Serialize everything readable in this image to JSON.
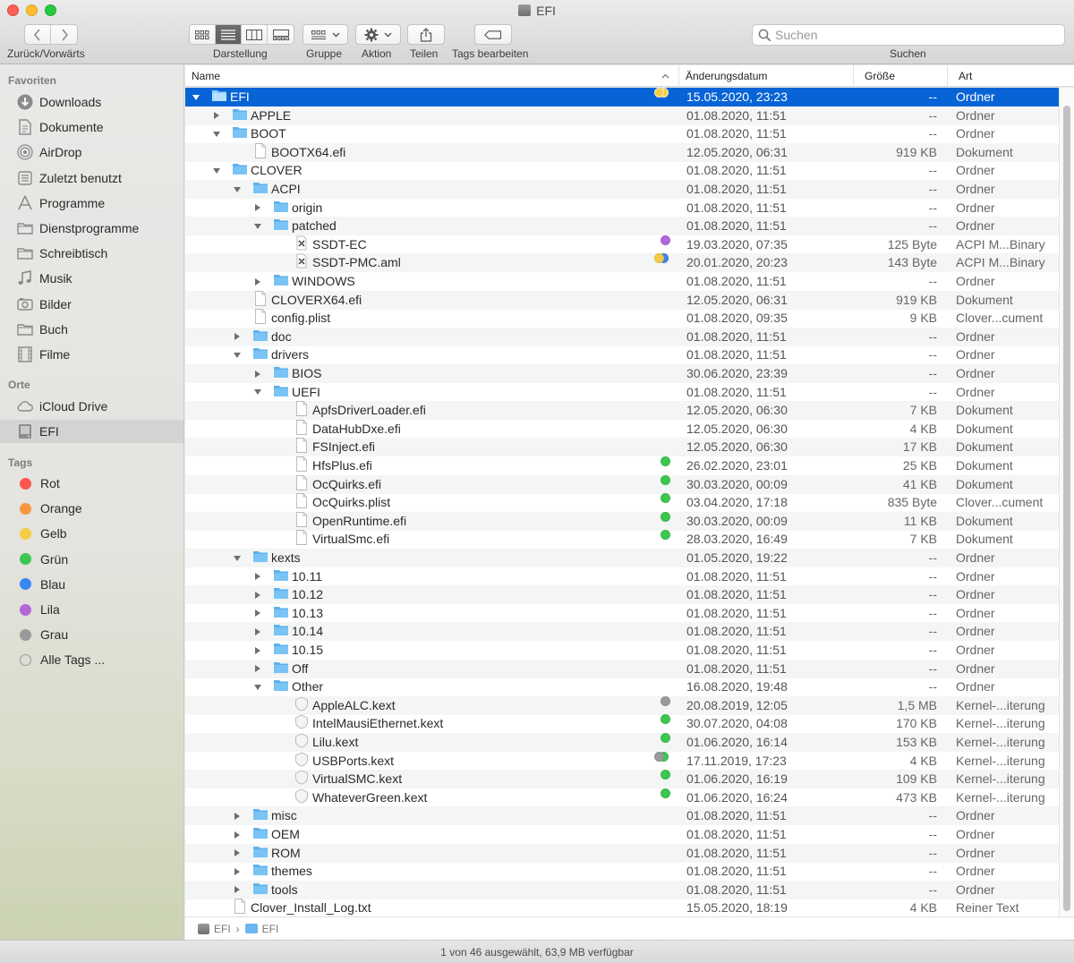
{
  "window": {
    "title": "EFI",
    "nav_label": "Zurück/Vorwärts",
    "toolbar": {
      "view_label": "Darstellung",
      "group_label": "Gruppe",
      "action_label": "Aktion",
      "share_label": "Teilen",
      "tags_label": "Tags bearbeiten",
      "search_label": "Suchen",
      "search_placeholder": "Suchen"
    }
  },
  "sidebar": {
    "favorites_heading": "Favoriten",
    "favorites": [
      {
        "label": "Downloads",
        "icon": "download-icon"
      },
      {
        "label": "Dokumente",
        "icon": "document-icon"
      },
      {
        "label": "AirDrop",
        "icon": "airdrop-icon"
      },
      {
        "label": "Zuletzt benutzt",
        "icon": "recents-icon"
      },
      {
        "label": "Programme",
        "icon": "applications-icon"
      },
      {
        "label": "Dienstprogramme",
        "icon": "folder-icon"
      },
      {
        "label": "Schreibtisch",
        "icon": "folder-icon"
      },
      {
        "label": "Musik",
        "icon": "music-icon"
      },
      {
        "label": "Bilder",
        "icon": "camera-icon"
      },
      {
        "label": "Buch",
        "icon": "folder-icon"
      },
      {
        "label": "Filme",
        "icon": "film-icon"
      }
    ],
    "locations_heading": "Orte",
    "locations": [
      {
        "label": "iCloud Drive",
        "icon": "cloud-icon"
      },
      {
        "label": "EFI",
        "icon": "drive-icon",
        "selected": true
      }
    ],
    "tags_heading": "Tags",
    "tags": [
      {
        "label": "Rot",
        "color": "#fa5650"
      },
      {
        "label": "Orange",
        "color": "#f8963c"
      },
      {
        "label": "Gelb",
        "color": "#f7cc45"
      },
      {
        "label": "Grün",
        "color": "#3cc750"
      },
      {
        "label": "Blau",
        "color": "#3b85f1"
      },
      {
        "label": "Lila",
        "color": "#b466d9"
      },
      {
        "label": "Grau",
        "color": "#9a9a9c"
      },
      {
        "label": "Alle Tags ...",
        "color": ""
      }
    ]
  },
  "columns": {
    "name": "Name",
    "date": "Änderungsdatum",
    "size": "Größe",
    "kind": "Art"
  },
  "files": [
    {
      "name": "EFI",
      "date": "15.05.2020, 23:23",
      "size": "--",
      "kind": "Ordner",
      "depth": 0,
      "type": "folder",
      "disclosure": "open",
      "tags": [
        "#f7cc45",
        "#f7cc45"
      ],
      "selected": true
    },
    {
      "name": "APPLE",
      "date": "01.08.2020, 11:51",
      "size": "--",
      "kind": "Ordner",
      "depth": 1,
      "type": "folder",
      "disclosure": "closed",
      "tags": []
    },
    {
      "name": "BOOT",
      "date": "01.08.2020, 11:51",
      "size": "--",
      "kind": "Ordner",
      "depth": 1,
      "type": "folder",
      "disclosure": "open",
      "tags": []
    },
    {
      "name": "BOOTX64.efi",
      "date": "12.05.2020, 06:31",
      "size": "919 KB",
      "kind": "Dokument",
      "depth": 2,
      "type": "doc",
      "disclosure": "",
      "tags": []
    },
    {
      "name": "CLOVER",
      "date": "01.08.2020, 11:51",
      "size": "--",
      "kind": "Ordner",
      "depth": 1,
      "type": "folder",
      "disclosure": "open",
      "tags": []
    },
    {
      "name": "ACPI",
      "date": "01.08.2020, 11:51",
      "size": "--",
      "kind": "Ordner",
      "depth": 2,
      "type": "folder",
      "disclosure": "open",
      "tags": []
    },
    {
      "name": "origin",
      "date": "01.08.2020, 11:51",
      "size": "--",
      "kind": "Ordner",
      "depth": 3,
      "type": "folder",
      "disclosure": "closed",
      "tags": []
    },
    {
      "name": "patched",
      "date": "01.08.2020, 11:51",
      "size": "--",
      "kind": "Ordner",
      "depth": 3,
      "type": "folder",
      "disclosure": "open",
      "tags": []
    },
    {
      "name": "SSDT-EC",
      "date": "19.03.2020, 07:35",
      "size": "125 Byte",
      "kind": "ACPI M...Binary",
      "depth": 4,
      "type": "binary",
      "disclosure": "",
      "tags": [
        "#b466d9"
      ]
    },
    {
      "name": "SSDT-PMC.aml",
      "date": "20.01.2020, 20:23",
      "size": "143 Byte",
      "kind": "ACPI M...Binary",
      "depth": 4,
      "type": "binary",
      "disclosure": "",
      "tags": [
        "#f7cc45",
        "#3b85f1"
      ]
    },
    {
      "name": "WINDOWS",
      "date": "01.08.2020, 11:51",
      "size": "--",
      "kind": "Ordner",
      "depth": 3,
      "type": "folder",
      "disclosure": "closed",
      "tags": []
    },
    {
      "name": "CLOVERX64.efi",
      "date": "12.05.2020, 06:31",
      "size": "919 KB",
      "kind": "Dokument",
      "depth": 2,
      "type": "doc",
      "disclosure": "",
      "tags": []
    },
    {
      "name": "config.plist",
      "date": "01.08.2020, 09:35",
      "size": "9 KB",
      "kind": "Clover...cument",
      "depth": 2,
      "type": "doc",
      "disclosure": "",
      "tags": []
    },
    {
      "name": "doc",
      "date": "01.08.2020, 11:51",
      "size": "--",
      "kind": "Ordner",
      "depth": 2,
      "type": "folder",
      "disclosure": "closed",
      "tags": []
    },
    {
      "name": "drivers",
      "date": "01.08.2020, 11:51",
      "size": "--",
      "kind": "Ordner",
      "depth": 2,
      "type": "folder",
      "disclosure": "open",
      "tags": []
    },
    {
      "name": "BIOS",
      "date": "30.06.2020, 23:39",
      "size": "--",
      "kind": "Ordner",
      "depth": 3,
      "type": "folder",
      "disclosure": "closed",
      "tags": []
    },
    {
      "name": "UEFI",
      "date": "01.08.2020, 11:51",
      "size": "--",
      "kind": "Ordner",
      "depth": 3,
      "type": "folder",
      "disclosure": "open",
      "tags": []
    },
    {
      "name": "ApfsDriverLoader.efi",
      "date": "12.05.2020, 06:30",
      "size": "7 KB",
      "kind": "Dokument",
      "depth": 4,
      "type": "doc",
      "disclosure": "",
      "tags": []
    },
    {
      "name": "DataHubDxe.efi",
      "date": "12.05.2020, 06:30",
      "size": "4 KB",
      "kind": "Dokument",
      "depth": 4,
      "type": "doc",
      "disclosure": "",
      "tags": []
    },
    {
      "name": "FSInject.efi",
      "date": "12.05.2020, 06:30",
      "size": "17 KB",
      "kind": "Dokument",
      "depth": 4,
      "type": "doc",
      "disclosure": "",
      "tags": []
    },
    {
      "name": "HfsPlus.efi",
      "date": "26.02.2020, 23:01",
      "size": "25 KB",
      "kind": "Dokument",
      "depth": 4,
      "type": "doc",
      "disclosure": "",
      "tags": [
        "#3cc750"
      ]
    },
    {
      "name": "OcQuirks.efi",
      "date": "30.03.2020, 00:09",
      "size": "41 KB",
      "kind": "Dokument",
      "depth": 4,
      "type": "doc",
      "disclosure": "",
      "tags": [
        "#3cc750"
      ]
    },
    {
      "name": "OcQuirks.plist",
      "date": "03.04.2020, 17:18",
      "size": "835 Byte",
      "kind": "Clover...cument",
      "depth": 4,
      "type": "doc",
      "disclosure": "",
      "tags": [
        "#3cc750"
      ]
    },
    {
      "name": "OpenRuntime.efi",
      "date": "30.03.2020, 00:09",
      "size": "11 KB",
      "kind": "Dokument",
      "depth": 4,
      "type": "doc",
      "disclosure": "",
      "tags": [
        "#3cc750"
      ]
    },
    {
      "name": "VirtualSmc.efi",
      "date": "28.03.2020, 16:49",
      "size": "7 KB",
      "kind": "Dokument",
      "depth": 4,
      "type": "doc",
      "disclosure": "",
      "tags": [
        "#3cc750"
      ]
    },
    {
      "name": "kexts",
      "date": "01.05.2020, 19:22",
      "size": "--",
      "kind": "Ordner",
      "depth": 2,
      "type": "folder",
      "disclosure": "open",
      "tags": []
    },
    {
      "name": "10.11",
      "date": "01.08.2020, 11:51",
      "size": "--",
      "kind": "Ordner",
      "depth": 3,
      "type": "folder",
      "disclosure": "closed",
      "tags": []
    },
    {
      "name": "10.12",
      "date": "01.08.2020, 11:51",
      "size": "--",
      "kind": "Ordner",
      "depth": 3,
      "type": "folder",
      "disclosure": "closed",
      "tags": []
    },
    {
      "name": "10.13",
      "date": "01.08.2020, 11:51",
      "size": "--",
      "kind": "Ordner",
      "depth": 3,
      "type": "folder",
      "disclosure": "closed",
      "tags": []
    },
    {
      "name": "10.14",
      "date": "01.08.2020, 11:51",
      "size": "--",
      "kind": "Ordner",
      "depth": 3,
      "type": "folder",
      "disclosure": "closed",
      "tags": []
    },
    {
      "name": "10.15",
      "date": "01.08.2020, 11:51",
      "size": "--",
      "kind": "Ordner",
      "depth": 3,
      "type": "folder",
      "disclosure": "closed",
      "tags": []
    },
    {
      "name": "Off",
      "date": "01.08.2020, 11:51",
      "size": "--",
      "kind": "Ordner",
      "depth": 3,
      "type": "folder",
      "disclosure": "closed",
      "tags": []
    },
    {
      "name": "Other",
      "date": "16.08.2020, 19:48",
      "size": "--",
      "kind": "Ordner",
      "depth": 3,
      "type": "folder",
      "disclosure": "open",
      "tags": []
    },
    {
      "name": "AppleALC.kext",
      "date": "20.08.2019, 12:05",
      "size": "1,5 MB",
      "kind": "Kernel-...iterung",
      "depth": 4,
      "type": "kext",
      "disclosure": "",
      "tags": [
        "#9a9a9c"
      ]
    },
    {
      "name": "IntelMausiEthernet.kext",
      "date": "30.07.2020, 04:08",
      "size": "170 KB",
      "kind": "Kernel-...iterung",
      "depth": 4,
      "type": "kext",
      "disclosure": "",
      "tags": [
        "#3cc750"
      ]
    },
    {
      "name": "Lilu.kext",
      "date": "01.06.2020, 16:14",
      "size": "153 KB",
      "kind": "Kernel-...iterung",
      "depth": 4,
      "type": "kext",
      "disclosure": "",
      "tags": [
        "#3cc750"
      ]
    },
    {
      "name": "USBPorts.kext",
      "date": "17.11.2019, 17:23",
      "size": "4 KB",
      "kind": "Kernel-...iterung",
      "depth": 4,
      "type": "kext",
      "disclosure": "",
      "tags": [
        "#9a9a9c",
        "#3cc750"
      ]
    },
    {
      "name": "VirtualSMC.kext",
      "date": "01.06.2020, 16:19",
      "size": "109 KB",
      "kind": "Kernel-...iterung",
      "depth": 4,
      "type": "kext",
      "disclosure": "",
      "tags": [
        "#3cc750"
      ]
    },
    {
      "name": "WhateverGreen.kext",
      "date": "01.06.2020, 16:24",
      "size": "473 KB",
      "kind": "Kernel-...iterung",
      "depth": 4,
      "type": "kext",
      "disclosure": "",
      "tags": [
        "#3cc750"
      ]
    },
    {
      "name": "misc",
      "date": "01.08.2020, 11:51",
      "size": "--",
      "kind": "Ordner",
      "depth": 2,
      "type": "folder",
      "disclosure": "closed",
      "tags": []
    },
    {
      "name": "OEM",
      "date": "01.08.2020, 11:51",
      "size": "--",
      "kind": "Ordner",
      "depth": 2,
      "type": "folder",
      "disclosure": "closed",
      "tags": []
    },
    {
      "name": "ROM",
      "date": "01.08.2020, 11:51",
      "size": "--",
      "kind": "Ordner",
      "depth": 2,
      "type": "folder",
      "disclosure": "closed",
      "tags": []
    },
    {
      "name": "themes",
      "date": "01.08.2020, 11:51",
      "size": "--",
      "kind": "Ordner",
      "depth": 2,
      "type": "folder",
      "disclosure": "closed",
      "tags": []
    },
    {
      "name": "tools",
      "date": "01.08.2020, 11:51",
      "size": "--",
      "kind": "Ordner",
      "depth": 2,
      "type": "folder",
      "disclosure": "closed",
      "tags": []
    },
    {
      "name": "Clover_Install_Log.txt",
      "date": "15.05.2020, 18:19",
      "size": "4 KB",
      "kind": "Reiner Text",
      "depth": 1,
      "type": "doc",
      "disclosure": "",
      "tags": []
    }
  ],
  "pathbar": {
    "drive": "EFI",
    "separator": "›",
    "folder": "EFI"
  },
  "status": "1 von 46 ausgewählt, 63,9 MB verfügbar",
  "colors": {
    "selection": "#0864d6",
    "folder": "#69b6f0"
  }
}
